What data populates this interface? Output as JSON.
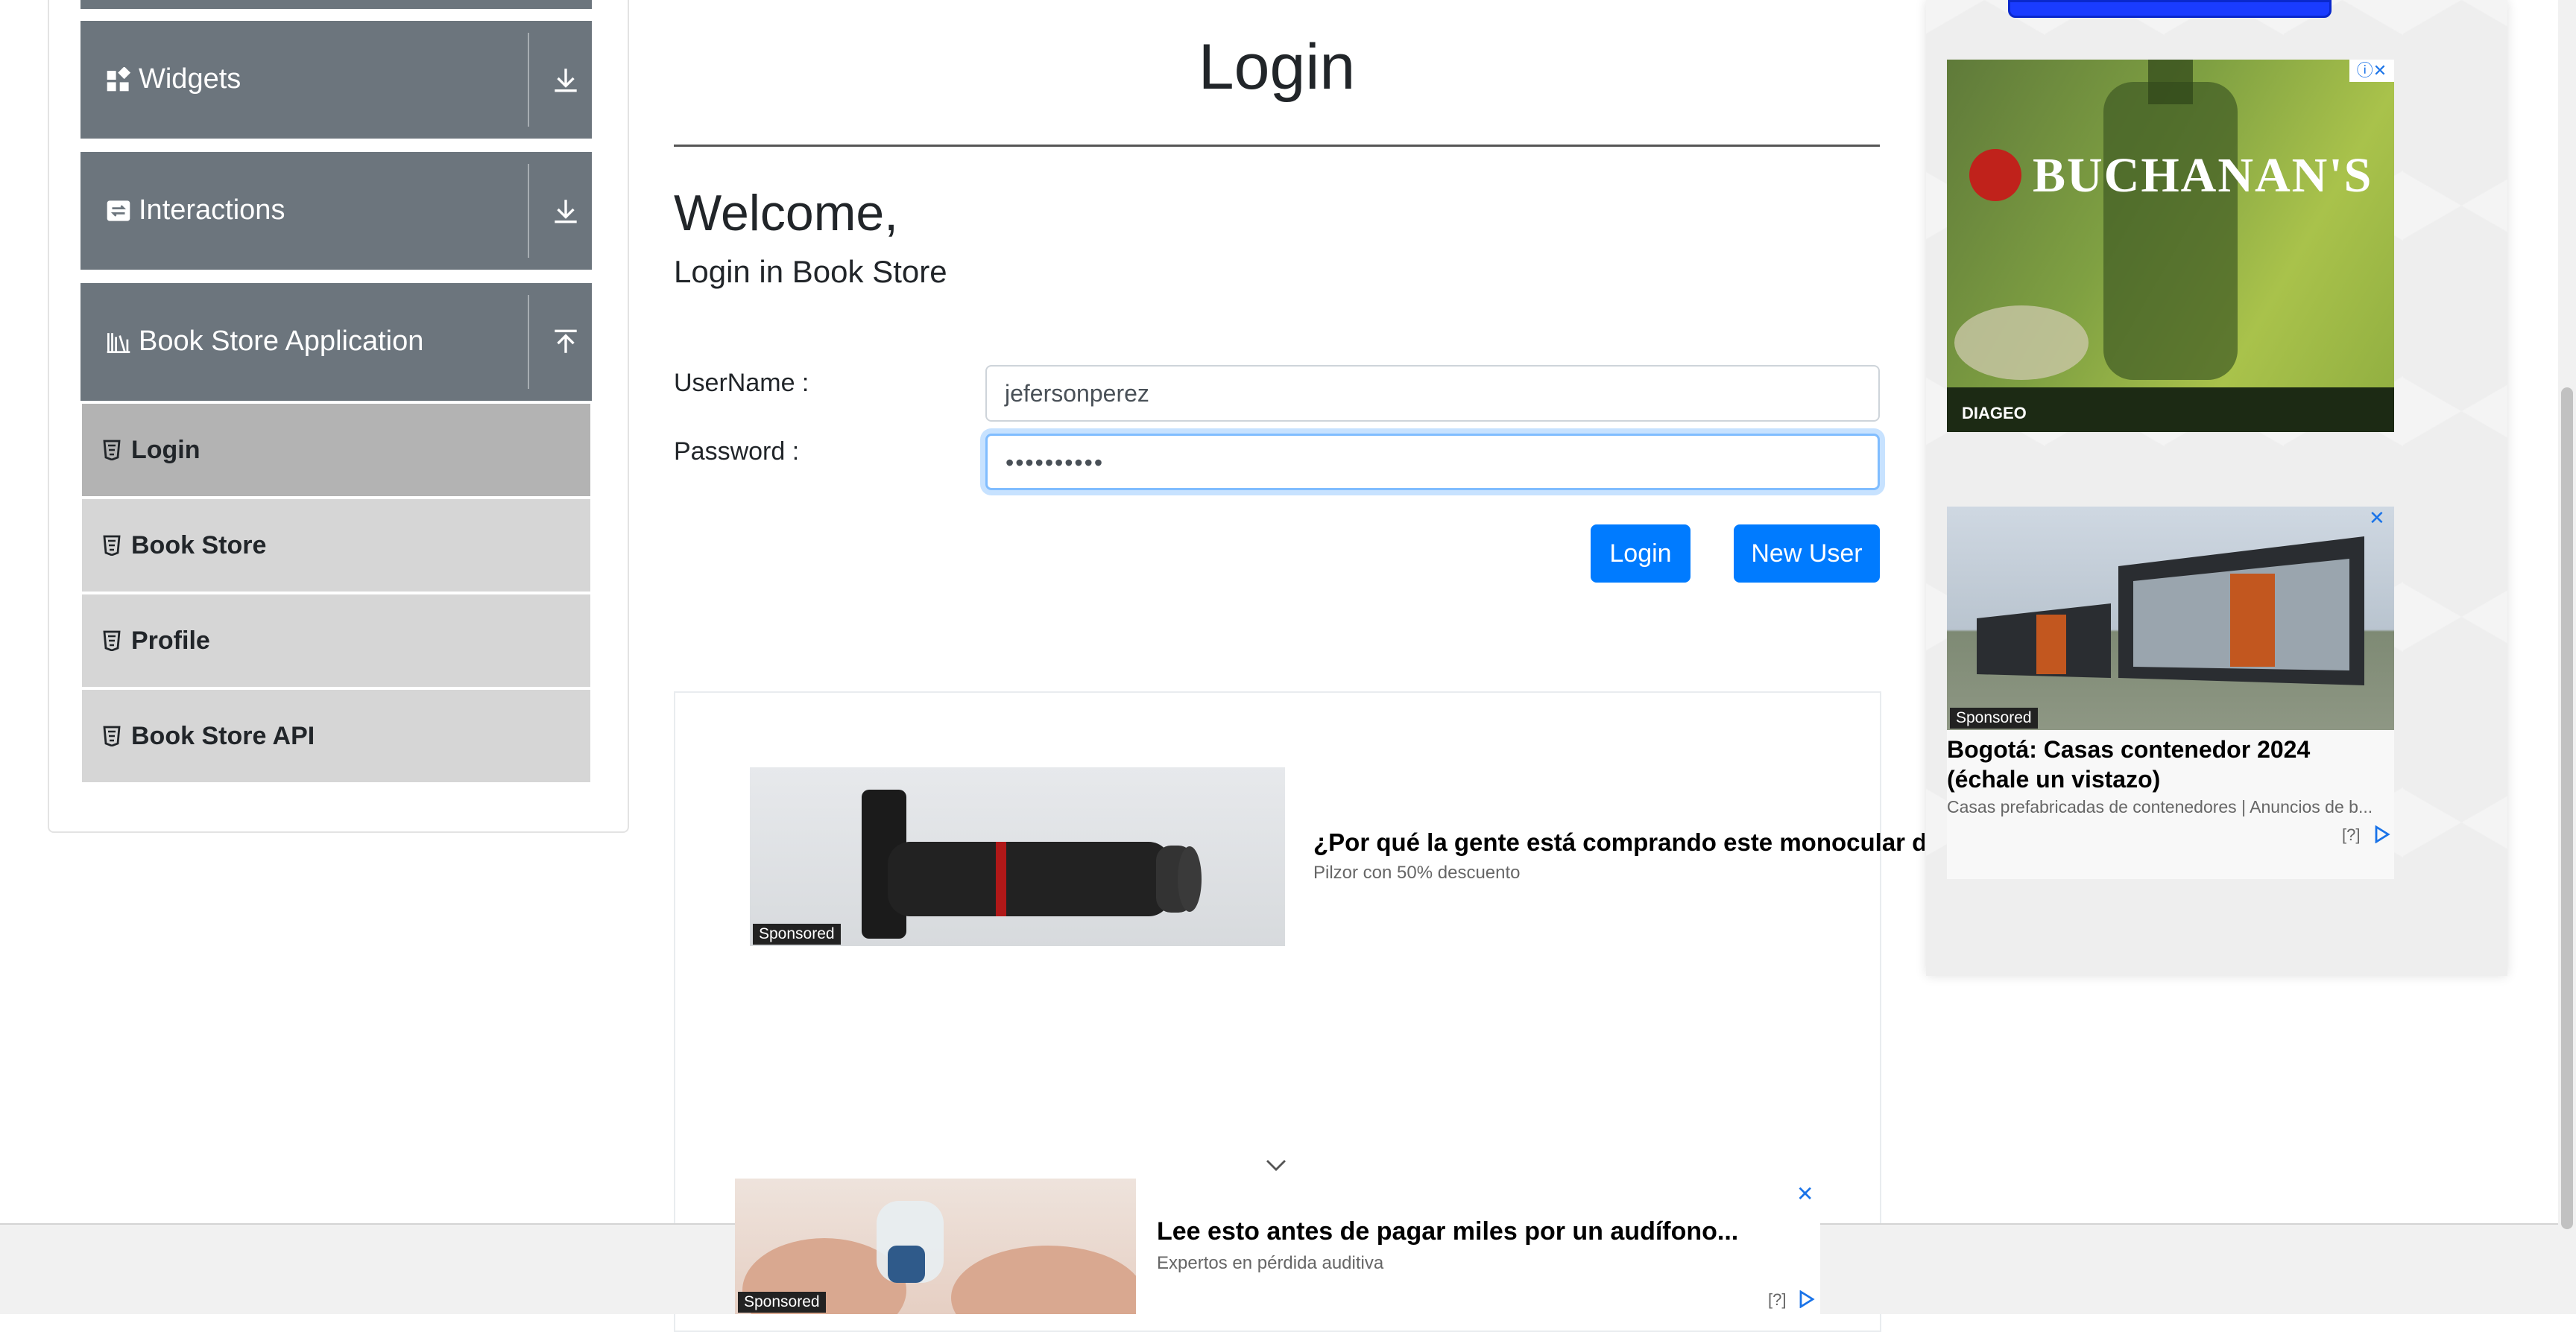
{
  "sidebar": {
    "groups": [
      {
        "label": "Widgets",
        "icon": "widgets-icon",
        "toggle": "download-arrow-icon"
      },
      {
        "label": "Interactions",
        "icon": "interactions-icon",
        "toggle": "download-arrow-icon"
      },
      {
        "label": "Book Store Application",
        "icon": "books-icon",
        "toggle": "upload-arrow-icon"
      }
    ],
    "items": [
      {
        "label": "Login",
        "active": true
      },
      {
        "label": "Book Store",
        "active": false
      },
      {
        "label": "Profile",
        "active": false
      },
      {
        "label": "Book Store API",
        "active": false
      }
    ]
  },
  "main": {
    "title": "Login",
    "welcome": "Welcome,",
    "subtitle": "Login in Book Store",
    "username_label": "UserName :",
    "username_value": "jefersonperez",
    "password_label": "Password :",
    "password_value": "••••••••••",
    "login_button": "Login",
    "new_user_button": "New User"
  },
  "ads": {
    "main": {
      "headline": "¿Por qué la gente está comprando este monocular de",
      "source": "Pilzor con 50% descuento",
      "sponsored": "Sponsored"
    },
    "whisky": {
      "brand": "BUCHANAN'S",
      "maker": "DIAGEO"
    },
    "house": {
      "headline": "Bogotá: Casas contenedor 2024 (échale un vistazo)",
      "source": "Casas prefabricadas de contenedores | Anuncios de b...",
      "sponsored": "Sponsored",
      "info": "[?]"
    },
    "bottom": {
      "headline": "Lee esto antes de pagar miles por un audífono...",
      "source": "Expertos en pérdida auditiva",
      "sponsored": "Sponsored",
      "info": "[?]"
    }
  },
  "colors": {
    "primary": "#007bff",
    "menu_header": "#6c757d",
    "menu_item": "#d6d6d6",
    "menu_active": "#b3b3b3"
  }
}
